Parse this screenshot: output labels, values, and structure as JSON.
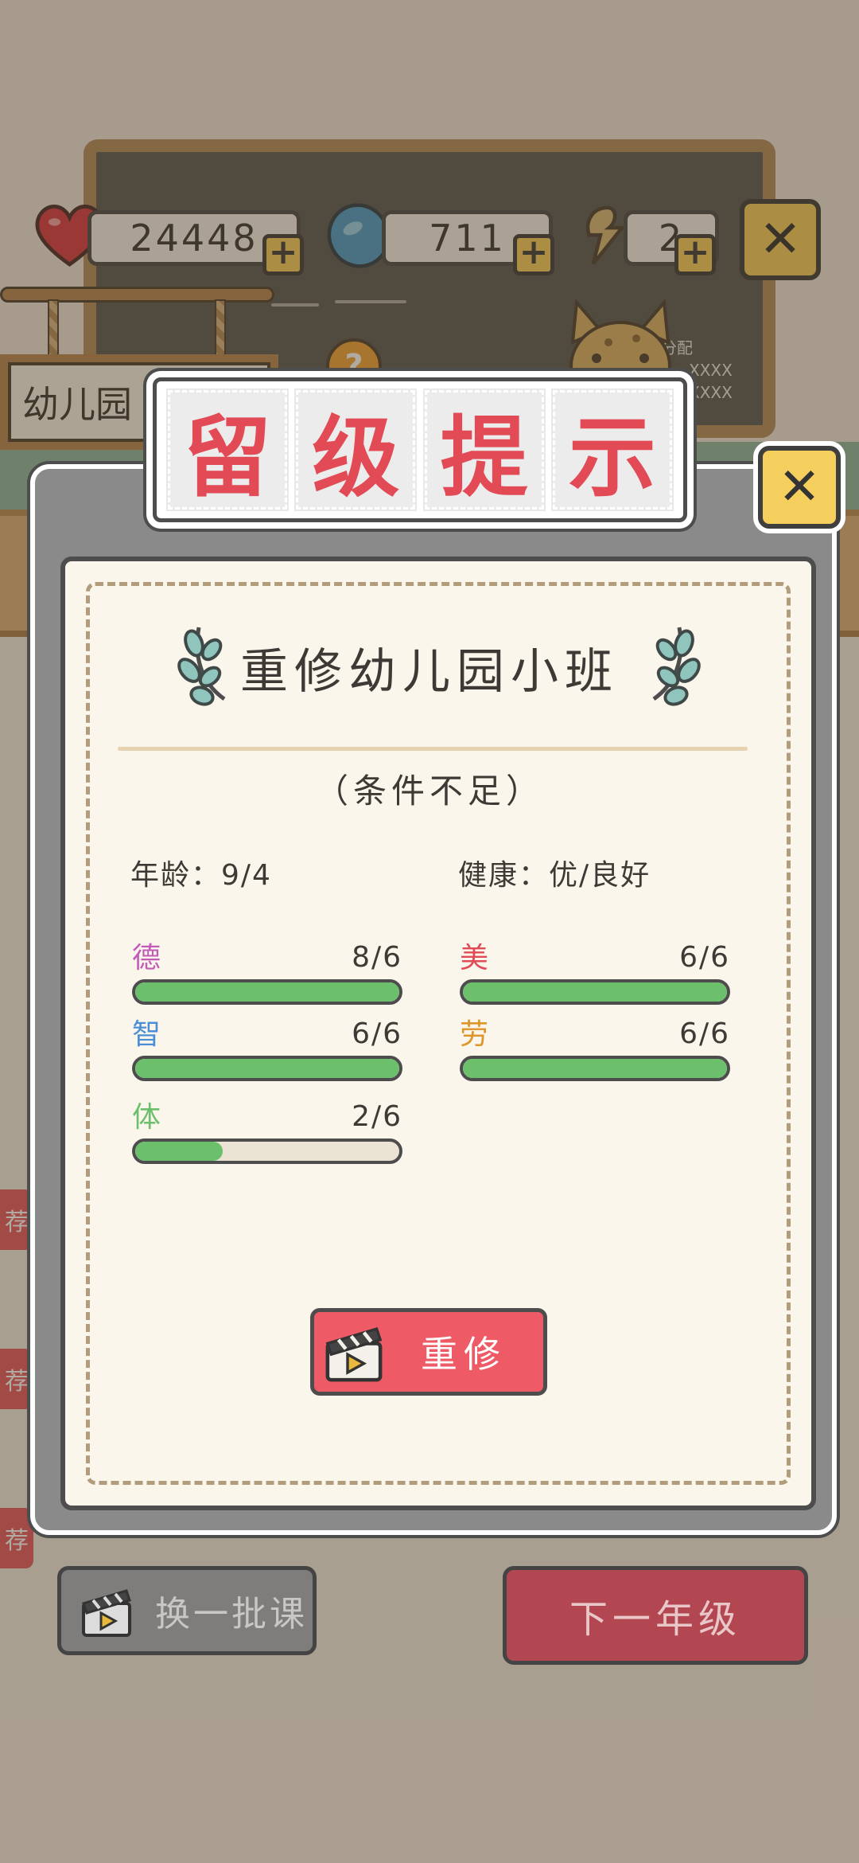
{
  "hud": {
    "hearts": "24448",
    "coins": "711",
    "energy": "2",
    "plus": "+",
    "close": "✕"
  },
  "scene": {
    "sign_label": "幼儿园",
    "question": "?",
    "side_tag": "荐",
    "board_line1": "日分配",
    "board_line2": "XXXX",
    "board_line3": "XXXX"
  },
  "modal": {
    "title_chars": [
      "留",
      "级",
      "提",
      "示"
    ],
    "close": "✕",
    "course": "重修幼儿园小班",
    "condition": "（条件不足）",
    "age_label": "年龄：9/4",
    "health_label": "健康：优/良好",
    "stats": [
      {
        "name": "德",
        "value": "8/6",
        "progress": 1.0,
        "color": "#c45ab8"
      },
      {
        "name": "智",
        "value": "6/6",
        "progress": 1.0,
        "color": "#4a8fd6"
      },
      {
        "name": "体",
        "value": "2/6",
        "progress": 0.33,
        "color": "#6cc06c"
      },
      {
        "name": "美",
        "value": "6/6",
        "progress": 1.0,
        "color": "#e04b55"
      },
      {
        "name": "劳",
        "value": "6/6",
        "progress": 1.0,
        "color": "#e0952b"
      }
    ],
    "retake_button": "重修"
  },
  "bottom": {
    "change_batch": "换一批课",
    "next_grade": "下一年级"
  },
  "colors": {
    "accent_red": "#ee5b66",
    "title_red": "#e24b55",
    "close_yellow": "#f4cf5e",
    "progress_green": "#6cc06c"
  }
}
